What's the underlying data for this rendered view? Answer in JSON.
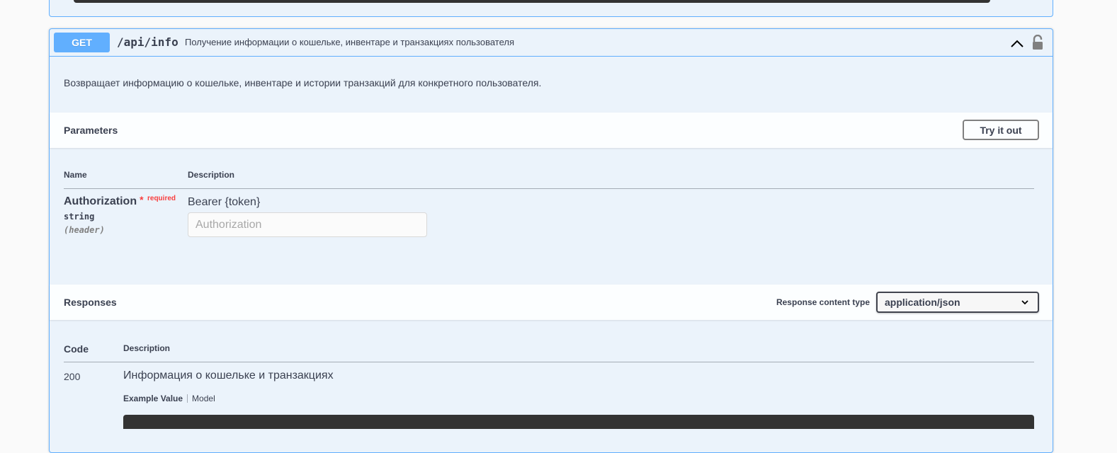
{
  "colors": {
    "get_blue": "#61affe",
    "block_bg": "#ebf3fb",
    "text": "#3b4151",
    "required_red": "#f93e3e"
  },
  "operation": {
    "method": "GET",
    "path": "/api/info",
    "summary": "Получение информации о кошельке, инвентаре и транзакциях пользователя",
    "description": "Возвращает информацию о кошельке, инвентаре и истории транзакций для конкретного пользователя.",
    "collapse_icon": "chevron-up-icon",
    "lock_icon": "unlocked-lock-icon"
  },
  "parameters": {
    "title": "Parameters",
    "try_button": "Try it out",
    "col_name": "Name",
    "col_description": "Description",
    "items": [
      {
        "name": "Authorization",
        "required_star": "*",
        "required_label": "required",
        "type": "string",
        "in": "(header)",
        "description": "Bearer {token}",
        "placeholder": "Authorization",
        "value": ""
      }
    ]
  },
  "responses": {
    "title": "Responses",
    "content_type_label": "Response content type",
    "content_type_value": "application/json",
    "col_code": "Code",
    "col_description": "Description",
    "items": [
      {
        "code": "200",
        "description": "Информация о кошельке и транзакциях",
        "tab_example": "Example Value",
        "tab_model": "Model"
      }
    ]
  }
}
